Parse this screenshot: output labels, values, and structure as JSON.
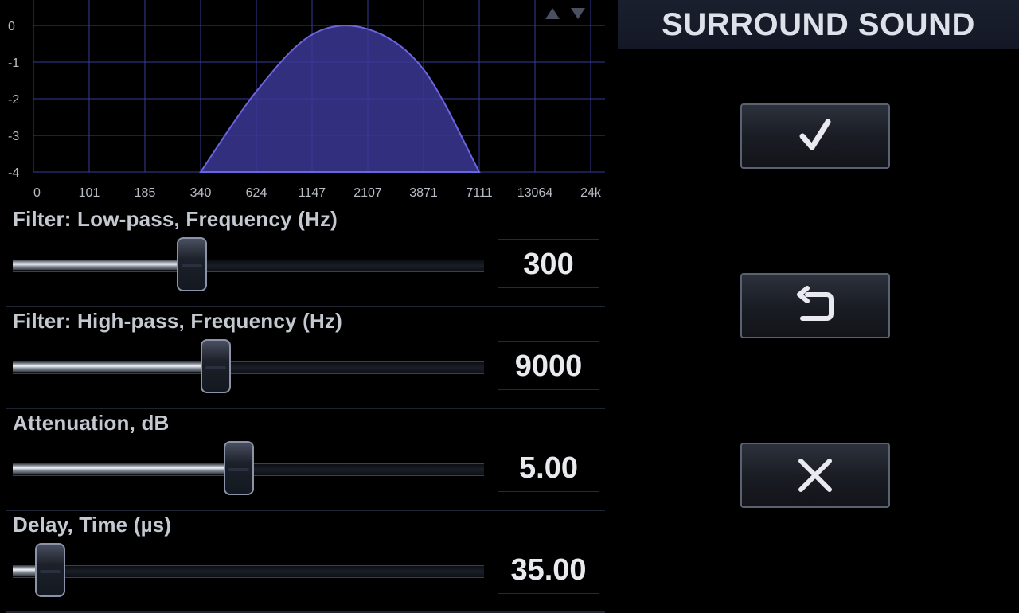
{
  "header": {
    "title": "SURROUND SOUND"
  },
  "chart_data": {
    "type": "area",
    "y_ticks": [
      "0",
      "-1",
      "-2",
      "-3",
      "-4"
    ],
    "x_ticks": [
      "0",
      "101",
      "185",
      "340",
      "624",
      "1147",
      "2107",
      "3871",
      "7111",
      "13064",
      "24k"
    ],
    "ylim": [
      -4,
      0
    ],
    "grid": true,
    "fill_color": "#3b3794",
    "line_color": "#6a64e0",
    "series": [
      {
        "x": [
          "340",
          "624",
          "1147",
          "2107",
          "3871",
          "7111"
        ],
        "y": [
          -4.0,
          -1.8,
          -0.25,
          -0.1,
          -1.2,
          -4.0
        ]
      }
    ]
  },
  "controls": [
    {
      "label": "Filter: Low-pass, Frequency (Hz)",
      "value": "300",
      "fraction": 0.38
    },
    {
      "label": "Filter: High-pass, Frequency (Hz)",
      "value": "9000",
      "fraction": 0.43
    },
    {
      "label": "Attenuation, dB",
      "value": "5.00",
      "fraction": 0.48
    },
    {
      "label": "Delay, Time (µs)",
      "value": "35.00",
      "fraction": 0.08
    }
  ],
  "buttons": {
    "apply_icon": "checkmark-icon",
    "reset_icon": "undo-icon",
    "cancel_icon": "close-icon"
  },
  "colors": {
    "accent": "#8a93a8",
    "title_bg": "#1a1f2e"
  }
}
